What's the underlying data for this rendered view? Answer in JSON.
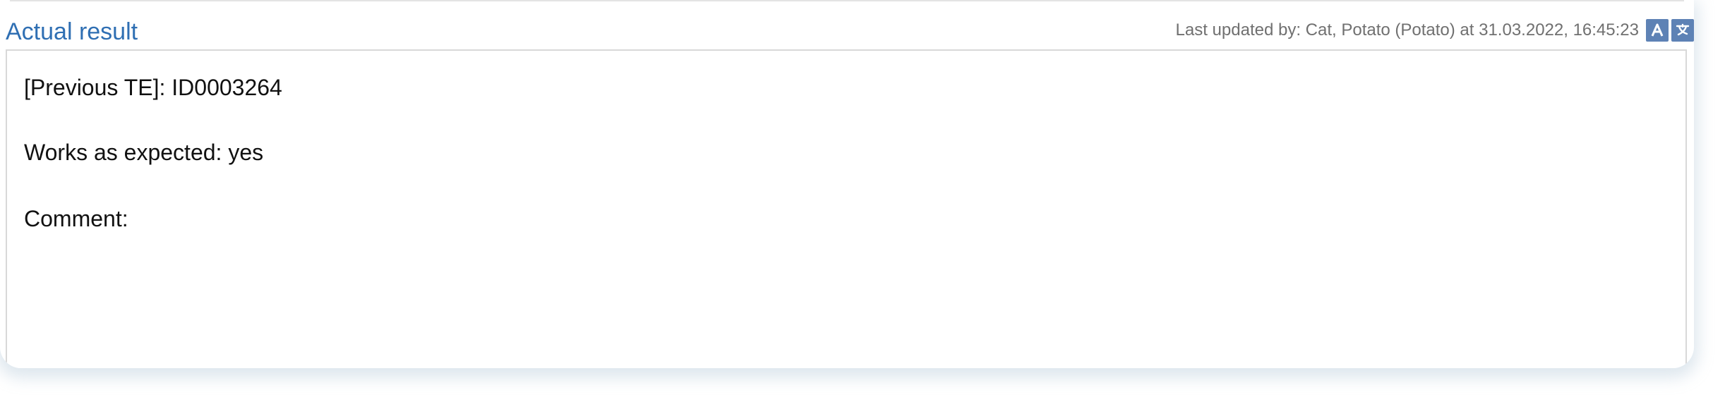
{
  "section": {
    "title": "Actual result",
    "meta_text": "Last updated by: Cat, Potato (Potato) at 31.03.2022, 16:45:23"
  },
  "toolbar": {
    "format_icon": "text-format-icon",
    "translate_icon": "translate-icon",
    "accent_color": "#5e82b5",
    "title_color": "#2f6fb3"
  },
  "content": {
    "paragraphs": [
      "[Previous TE]: ID0003264",
      "Works as expected: yes",
      "Comment:"
    ]
  }
}
